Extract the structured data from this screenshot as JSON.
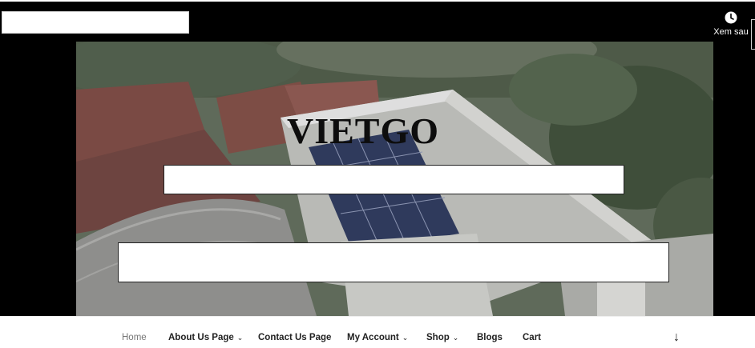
{
  "video": {
    "watch_later_label": "Xem sau",
    "brand": "VIETGO"
  },
  "nav": {
    "items": [
      {
        "label": "Home",
        "dropdown": false,
        "current": true
      },
      {
        "label": "About Us Page",
        "dropdown": true
      },
      {
        "label": "Contact Us Page",
        "dropdown": false
      },
      {
        "label": "My Account",
        "dropdown": true
      },
      {
        "label": "Shop",
        "dropdown": true
      },
      {
        "label": "Blogs",
        "dropdown": false
      },
      {
        "label": "Cart",
        "dropdown": false
      }
    ],
    "dropdown_icon": "chevron-down-icon",
    "scroll_icon": "arrow-down-icon"
  },
  "colors": {
    "frame": "#000000",
    "nav_text": "#222222",
    "nav_current": "#767676"
  }
}
